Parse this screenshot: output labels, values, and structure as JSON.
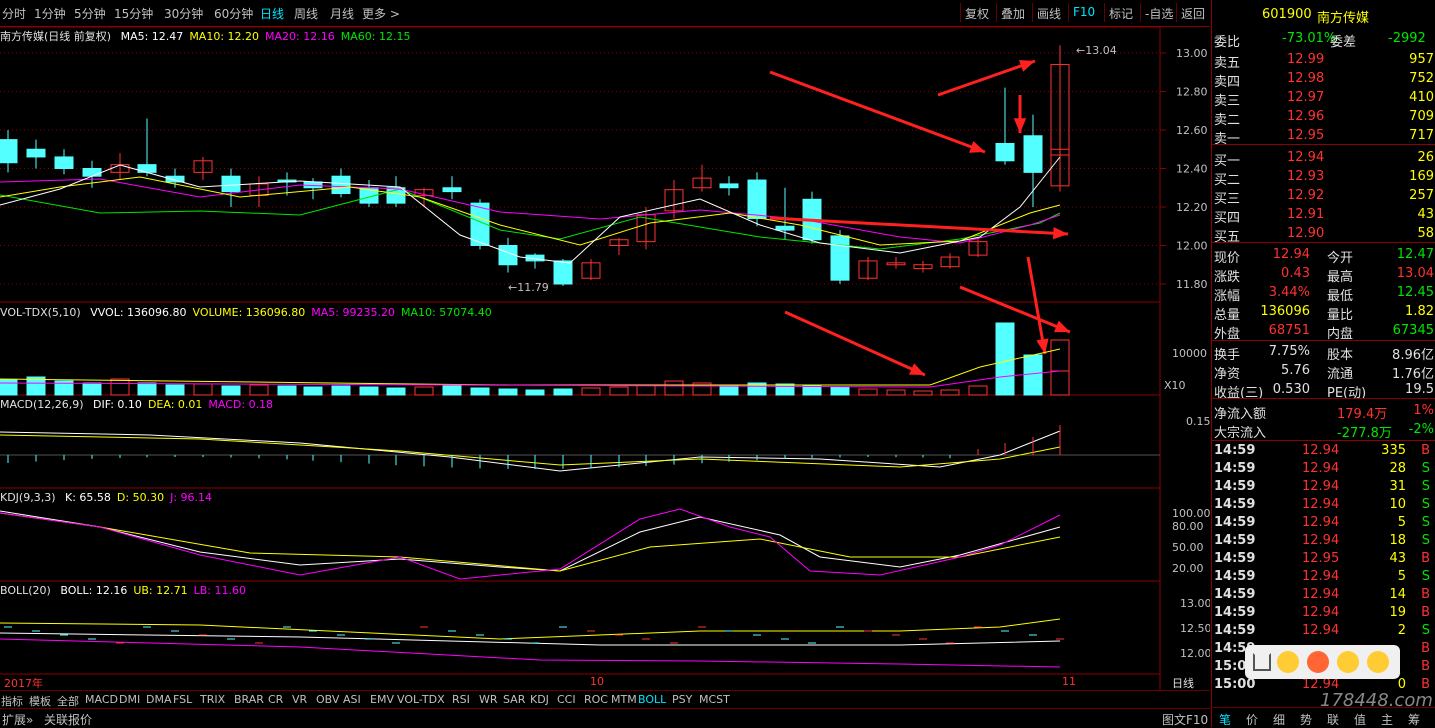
{
  "toolbar": {
    "periods": [
      "分时",
      "1分钟",
      "5分钟",
      "15分钟",
      "30分钟",
      "60分钟",
      "日线",
      "周线",
      "月线",
      "更多 >"
    ],
    "active_period": "日线",
    "buttons": [
      "复权",
      "叠加",
      "画线",
      "F10",
      "标记",
      "-自选",
      "返回"
    ]
  },
  "main_panel": {
    "title": "南方传媒(日线 前复权)",
    "ma": [
      {
        "label": "MA5: 12.47",
        "color": "#ffffff"
      },
      {
        "label": "MA10: 12.20",
        "color": "#ffff00"
      },
      {
        "label": "MA20: 12.16",
        "color": "#ff00ff"
      },
      {
        "label": "MA60: 12.15",
        "color": "#00e600"
      }
    ],
    "y_ticks": [
      "13.00",
      "12.80",
      "12.60",
      "12.40",
      "12.20",
      "12.00",
      "11.80"
    ],
    "high_label": "13.04",
    "low_label": "11.79"
  },
  "vol_panel": {
    "title": "VOL-TDX(5,10)",
    "items": [
      {
        "label": "VVOL: 136096.80",
        "color": "#ffffff"
      },
      {
        "label": "VOLUME: 136096.80",
        "color": "#ffff00"
      },
      {
        "label": "MA5: 99235.20",
        "color": "#ff00ff"
      },
      {
        "label": "MA10: 57074.40",
        "color": "#00e600"
      }
    ],
    "y_tick": "10000",
    "unit": "X10"
  },
  "macd_panel": {
    "title": "MACD(12,26,9)",
    "items": [
      {
        "label": "DIF: 0.10",
        "color": "#ffffff"
      },
      {
        "label": "DEA: 0.01",
        "color": "#ffff00"
      },
      {
        "label": "MACD: 0.18",
        "color": "#ff00ff"
      }
    ],
    "y_tick": "0.15"
  },
  "kdj_panel": {
    "title": "KDJ(9,3,3)",
    "items": [
      {
        "label": "K: 65.58",
        "color": "#ffffff"
      },
      {
        "label": "D: 50.30",
        "color": "#ffff00"
      },
      {
        "label": "J: 96.14",
        "color": "#ff00ff"
      }
    ],
    "y_ticks": [
      "100.00",
      "80.00",
      "50.00",
      "20.00"
    ]
  },
  "boll_panel": {
    "title": "BOLL(20)",
    "items": [
      {
        "label": "BOLL: 12.16",
        "color": "#ffffff"
      },
      {
        "label": "UB: 12.71",
        "color": "#ffff00"
      },
      {
        "label": "LB: 11.60",
        "color": "#ff00ff"
      }
    ],
    "y_ticks": [
      "13.00",
      "12.50",
      "12.00"
    ]
  },
  "date_axis": {
    "year": "2017年",
    "m10": "10",
    "m11": "11"
  },
  "indicator_tabs": [
    "指标",
    "模板",
    "全部",
    "MACD",
    "DMI",
    "DMA",
    "FSL",
    "TRIX",
    "BRAR",
    "CR",
    "VR",
    "OBV",
    "ASI",
    "EMV",
    "VOL-TDX",
    "RSI",
    "WR",
    "SAR",
    "KDJ",
    "CCI",
    "ROC",
    "MTM",
    "BOLL",
    "PSY",
    "MCST"
  ],
  "active_tab": "BOLL",
  "status": {
    "left1": "扩展»",
    "left2": "关联报价",
    "daily": "日线",
    "f10": "图文F10"
  },
  "quote": {
    "code": "601900",
    "name": "南方传媒",
    "weibi_label": "委比",
    "weibi": "-73.01%",
    "weicha_label": "委差",
    "weicha": "-2992",
    "asks": [
      {
        "label": "卖五",
        "price": "12.99",
        "vol": "957"
      },
      {
        "label": "卖四",
        "price": "12.98",
        "vol": "752"
      },
      {
        "label": "卖三",
        "price": "12.97",
        "vol": "410"
      },
      {
        "label": "卖二",
        "price": "12.96",
        "vol": "709"
      },
      {
        "label": "卖一",
        "price": "12.95",
        "vol": "717"
      }
    ],
    "bids": [
      {
        "label": "买一",
        "price": "12.94",
        "vol": "26"
      },
      {
        "label": "买二",
        "price": "12.93",
        "vol": "169"
      },
      {
        "label": "买三",
        "price": "12.92",
        "vol": "257"
      },
      {
        "label": "买四",
        "price": "12.91",
        "vol": "43"
      },
      {
        "label": "买五",
        "price": "12.90",
        "vol": "58"
      }
    ],
    "stats": [
      {
        "l1": "现价",
        "v1": "12.94",
        "c1": "red",
        "l2": "今开",
        "v2": "12.47",
        "c2": "green"
      },
      {
        "l1": "涨跌",
        "v1": "0.43",
        "c1": "red",
        "l2": "最高",
        "v2": "13.04",
        "c2": "red"
      },
      {
        "l1": "涨幅",
        "v1": "3.44%",
        "c1": "red",
        "l2": "最低",
        "v2": "12.45",
        "c2": "green"
      },
      {
        "l1": "总量",
        "v1": "136096",
        "c1": "yellow",
        "l2": "量比",
        "v2": "1.82",
        "c2": "yellow"
      },
      {
        "l1": "外盘",
        "v1": "68751",
        "c1": "red",
        "l2": "内盘",
        "v2": "67345",
        "c2": "green"
      }
    ],
    "stats2": [
      {
        "l1": "换手",
        "v1": "7.75%",
        "c1": "white",
        "l2": "股本",
        "v2": "8.96亿",
        "c2": "white"
      },
      {
        "l1": "净资",
        "v1": "5.76",
        "c1": "white",
        "l2": "流通",
        "v2": "1.76亿",
        "c2": "white"
      },
      {
        "l1": "收益(三)",
        "v1": "0.530",
        "c1": "white",
        "l2": "PE(动)",
        "v2": "19.5",
        "c2": "white"
      }
    ],
    "flows": [
      {
        "label": "净流入额",
        "val": "179.4万",
        "pct": "1%",
        "c": "red"
      },
      {
        "label": "大宗流入",
        "val": "-277.8万",
        "pct": "-2%",
        "c": "green"
      }
    ],
    "ticks": [
      {
        "t": "14:59",
        "p": "12.94",
        "v": "335",
        "s": "B"
      },
      {
        "t": "14:59",
        "p": "12.94",
        "v": "28",
        "s": "S"
      },
      {
        "t": "14:59",
        "p": "12.94",
        "v": "31",
        "s": "S"
      },
      {
        "t": "14:59",
        "p": "12.94",
        "v": "10",
        "s": "S"
      },
      {
        "t": "14:59",
        "p": "12.94",
        "v": "5",
        "s": "S"
      },
      {
        "t": "14:59",
        "p": "12.94",
        "v": "18",
        "s": "S"
      },
      {
        "t": "14:59",
        "p": "12.95",
        "v": "43",
        "s": "B"
      },
      {
        "t": "14:59",
        "p": "12.94",
        "v": "5",
        "s": "S"
      },
      {
        "t": "14:59",
        "p": "12.94",
        "v": "14",
        "s": "B"
      },
      {
        "t": "14:59",
        "p": "12.94",
        "v": "19",
        "s": "B"
      },
      {
        "t": "14:59",
        "p": "12.94",
        "v": "2",
        "s": "S"
      },
      {
        "t": "14:59",
        "p": "",
        "v": "",
        "s": "B"
      },
      {
        "t": "15:00",
        "p": "",
        "v": "",
        "s": "B"
      },
      {
        "t": "15:00",
        "p": "12.94",
        "v": "0",
        "s": "B"
      }
    ],
    "bottom_tabs": [
      "笔",
      "价",
      "细",
      "势",
      "联",
      "值",
      "主",
      "筹"
    ]
  },
  "watermark": "178448.com"
}
